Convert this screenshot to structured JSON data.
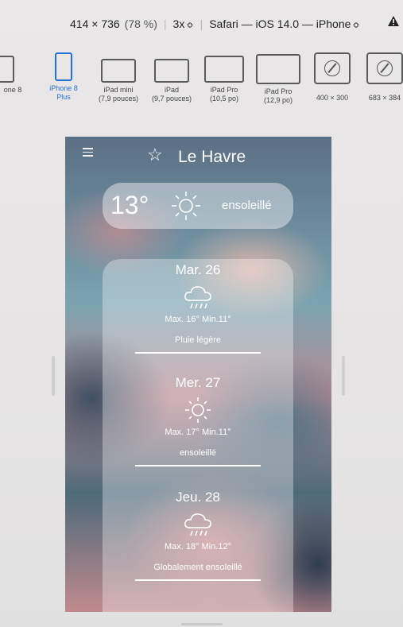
{
  "toolbar": {
    "dimensions": "414 × 736",
    "zoom": "(78 %)",
    "scale": "3x",
    "scale_chevron": "≎",
    "browser_device": "Safari — iOS 14.0 — iPhone",
    "browser_chevron": "≎",
    "warning_icon": "warning-icon"
  },
  "devices": [
    {
      "label": "one 8",
      "sub": ""
    },
    {
      "label": "iPhone 8",
      "sub": "Plus"
    },
    {
      "label": "iPad mini",
      "sub": "(7,9 pouces)"
    },
    {
      "label": "iPad",
      "sub": "(9,7 pouces)"
    },
    {
      "label": "iPad Pro",
      "sub": "(10,5 po)"
    },
    {
      "label": "iPad Pro",
      "sub": "(12,9 po)"
    },
    {
      "label": "400 × 300",
      "sub": ""
    },
    {
      "label": "683 × 384",
      "sub": ""
    }
  ],
  "weather": {
    "city": "Le Havre",
    "current_temp": "13°",
    "current_condition": "ensoleillé",
    "days": [
      {
        "date": "Mar. 26",
        "icon": "rain-cloud-icon",
        "minmax": "Max. 16° Min.11°",
        "desc": "Pluie légère"
      },
      {
        "date": "Mer. 27",
        "icon": "sun-icon",
        "minmax": "Max. 17° Min.11°",
        "desc": "ensoleillé"
      },
      {
        "date": "Jeu. 28",
        "icon": "rain-cloud-icon",
        "minmax": "Max. 18° Min.12°",
        "desc": "Globalement ensoleillé"
      }
    ]
  },
  "colors": {
    "active_device": "#2a6fd6"
  }
}
